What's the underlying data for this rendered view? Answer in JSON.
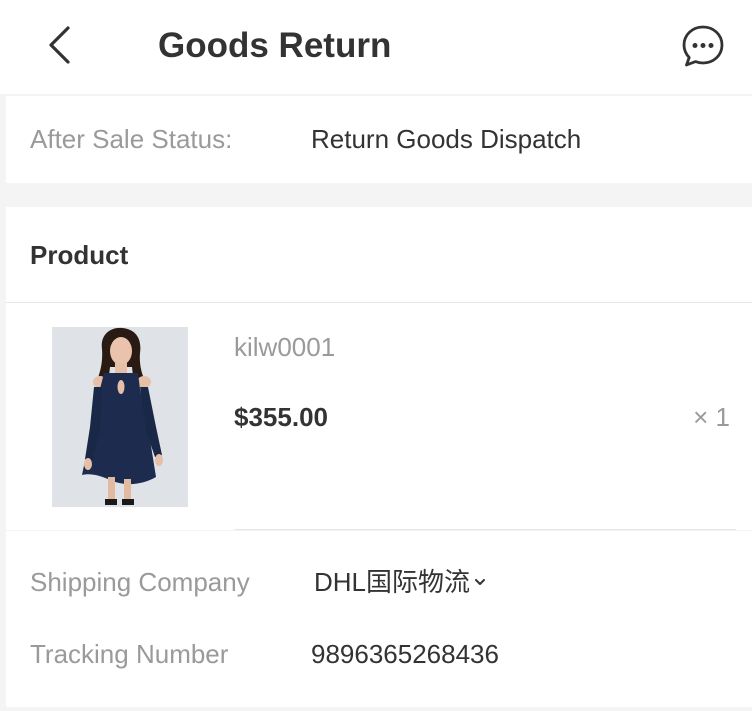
{
  "header": {
    "title": "Goods Return",
    "back_icon": "chevron-left-icon",
    "chat_icon": "chat-bubble-icon"
  },
  "status": {
    "label": "After Sale Status:",
    "value": "Return Goods Dispatch"
  },
  "product": {
    "heading": "Product",
    "sku": "kilw0001",
    "price": "$355.00",
    "quantity": "× 1"
  },
  "shipping": {
    "company_label": "Shipping Company",
    "company_value": "DHL国际物流",
    "tracking_label": "Tracking Number",
    "tracking_value": "9896365268436"
  },
  "colors": {
    "background": "#f4f4f4",
    "card": "#ffffff",
    "text_primary": "#333333",
    "text_secondary": "#9a9a9a",
    "divider": "#e6e6e6"
  }
}
